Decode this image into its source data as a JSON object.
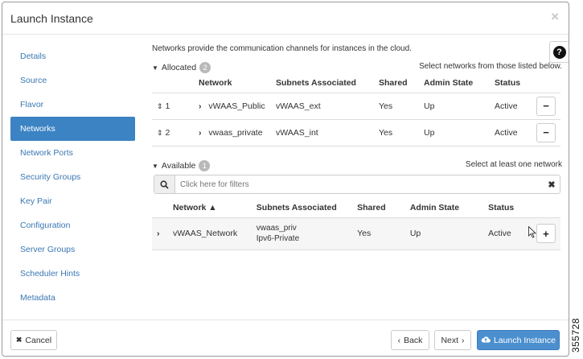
{
  "dialog": {
    "title": "Launch Instance",
    "close_glyph": "×"
  },
  "sidebar": {
    "items": [
      {
        "label": "Details"
      },
      {
        "label": "Source"
      },
      {
        "label": "Flavor"
      },
      {
        "label": "Networks",
        "active": true
      },
      {
        "label": "Network Ports"
      },
      {
        "label": "Security Groups"
      },
      {
        "label": "Key Pair"
      },
      {
        "label": "Configuration"
      },
      {
        "label": "Server Groups"
      },
      {
        "label": "Scheduler Hints"
      },
      {
        "label": "Metadata"
      }
    ]
  },
  "help": {
    "glyph": "?"
  },
  "main": {
    "description": "Networks provide the communication channels for instances in the cloud.",
    "allocated": {
      "title": "Allocated",
      "count": "2",
      "hint": "Select networks from those listed below.",
      "columns": [
        "Network",
        "Subnets Associated",
        "Shared",
        "Admin State",
        "Status"
      ],
      "rows": [
        {
          "order": "1",
          "network": "vWAAS_Public",
          "subnets": "vWAAS_ext",
          "shared": "Yes",
          "admin_state": "Up",
          "status": "Active",
          "action": "−"
        },
        {
          "order": "2",
          "network": "vwaas_private",
          "subnets": "vWAAS_int",
          "shared": "Yes",
          "admin_state": "Up",
          "status": "Active",
          "action": "−"
        }
      ]
    },
    "available": {
      "title": "Available",
      "count": "1",
      "hint": "Select at least one network",
      "filter_placeholder": "Click here for filters",
      "columns": [
        "Network ▲",
        "Subnets Associated",
        "Shared",
        "Admin State",
        "Status"
      ],
      "rows": [
        {
          "network": "vWAAS_Network",
          "subnets_line1": "vwaas_priv",
          "subnets_line2": "Ipv6-Private",
          "shared": "Yes",
          "admin_state": "Up",
          "status": "Active",
          "action": "+"
        }
      ]
    }
  },
  "footer": {
    "cancel_label": "Cancel",
    "back_label": "Back",
    "next_label": "Next",
    "launch_label": "Launch Instance"
  },
  "figure_id": "355728",
  "colors": {
    "accent": "#3b83c3",
    "link": "#3a77b3",
    "primary_button": "#4b8fcf"
  }
}
